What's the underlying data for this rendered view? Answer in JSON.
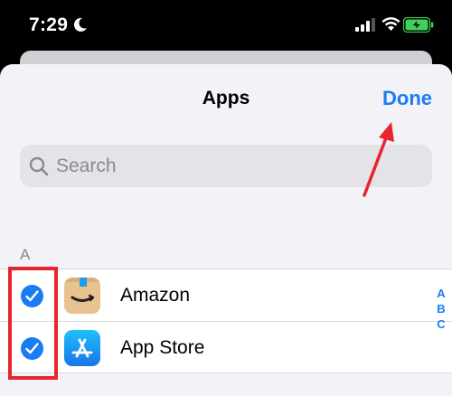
{
  "status_bar": {
    "time": "7:29"
  },
  "sheet": {
    "title": "Apps",
    "done_label": "Done"
  },
  "search": {
    "placeholder": "Search"
  },
  "section": {
    "header": "A"
  },
  "apps": [
    {
      "name": "Amazon",
      "checked": true,
      "icon": "amazon-icon"
    },
    {
      "name": "App Store",
      "checked": true,
      "icon": "app-store-icon"
    }
  ],
  "index_bar": [
    "A",
    "B",
    "C"
  ],
  "colors": {
    "accent": "#1a7cf5",
    "annotation": "#e8242f",
    "sheet_bg": "#f2f2f7"
  }
}
